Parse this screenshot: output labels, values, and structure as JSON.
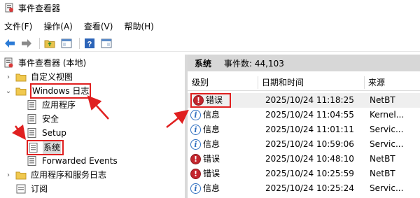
{
  "window": {
    "title": "事件查看器"
  },
  "menu": [
    "文件(F)",
    "操作(A)",
    "查看(V)",
    "帮助(H)"
  ],
  "toolbar": {
    "buttons": [
      "back-icon",
      "forward-icon",
      "folder-up-icon",
      "show-tree-icon",
      "help-icon",
      "show-action-pane-icon"
    ]
  },
  "tree": {
    "root": "事件查看器 (本地)",
    "custom_views": "自定义视图",
    "windows_logs": "Windows 日志",
    "application": "应用程序",
    "security": "安全",
    "setup": "Setup",
    "system": "系统",
    "forwarded": "Forwarded Events",
    "app_services": "应用程序和服务日志",
    "subscriptions": "订阅"
  },
  "pane": {
    "title": "系统",
    "count": "事件数: 44,103"
  },
  "table": {
    "headers": {
      "level": "级别",
      "datetime": "日期和时间",
      "source": "来源"
    },
    "rows": [
      {
        "level": "错误",
        "kind": "error",
        "datetime": "2025/10/24 11:18:25",
        "source": "NetBT"
      },
      {
        "level": "信息",
        "kind": "info",
        "datetime": "2025/10/24 11:04:55",
        "source": "Kernel..."
      },
      {
        "level": "信息",
        "kind": "info",
        "datetime": "2025/10/24 11:01:11",
        "source": "Servic..."
      },
      {
        "level": "信息",
        "kind": "info",
        "datetime": "2025/10/24 10:59:06",
        "source": "Servic..."
      },
      {
        "level": "错误",
        "kind": "error",
        "datetime": "2025/10/24 10:48:10",
        "source": "NetBT"
      },
      {
        "level": "错误",
        "kind": "error",
        "datetime": "2025/10/24 10:25:59",
        "source": "NetBT"
      },
      {
        "level": "信息",
        "kind": "info",
        "datetime": "2025/10/24 10:25:24",
        "source": "Servic..."
      }
    ]
  },
  "colors": {
    "highlight": "#e02020",
    "header_band": "#d7d7d7"
  }
}
